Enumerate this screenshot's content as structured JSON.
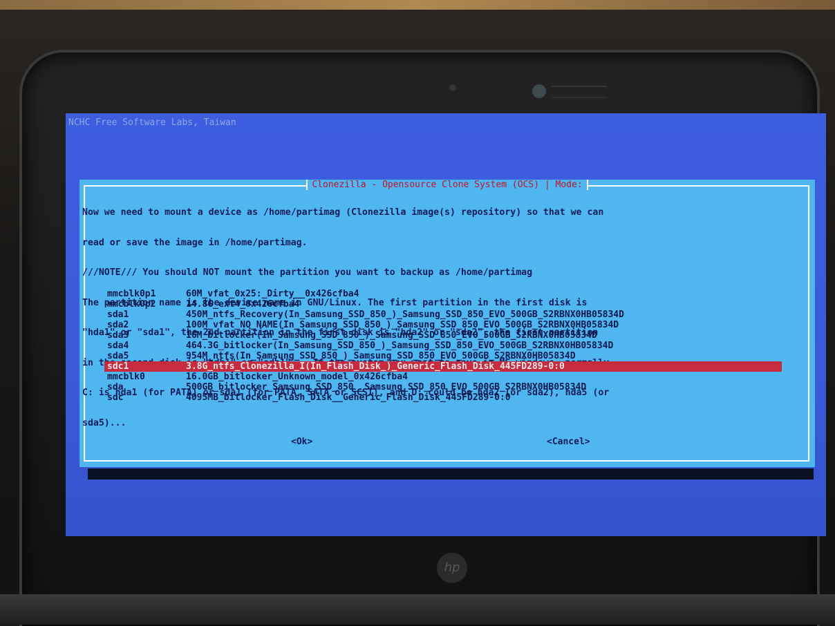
{
  "banner": "NCHC Free Software Labs, Taiwan",
  "dialog": {
    "title": "Clonezilla - Opensource Clone System (OCS) | Mode:",
    "message_lines": [
      "Now we need to mount a device as /home/partimag (Clonezilla image(s) repository) so that we can",
      "read or save the image in /home/partimag.",
      "///NOTE/// You should NOT mount the partition you want to backup as /home/partimag",
      "The partition name is the device name in GNU/Linux. The first partition in the first disk is",
      "\"hda1\" or \"sda1\", the 2nd partition in the first disk is \"hda2\" or \"sda2\", the first partition",
      "in the second disk is \"hdb1\" or \"sdb1\"... If the system you want to save is MS windows, normally",
      "C: is hda1 (for PATA) or sda1 (for PATA, SATA or SCSI), and D: could be hda2 (or sda2), hda5 (or",
      "sda5)..."
    ],
    "devices": [
      {
        "dev": "mmcblk0p1",
        "desc": "60M_vfat_0x25:_Dirty__0x426cfba4"
      },
      {
        "dev": "mmcblk0p2",
        "desc": "14.8G_ext4_0x426cfba4"
      },
      {
        "dev": "sda1",
        "desc": "450M_ntfs_Recovery(In_Samsung_SSD_850_)_Samsung_SSD_850_EVO_500GB_S2RBNX0HB05834D"
      },
      {
        "dev": "sda2",
        "desc": "100M_vfat_NO_NAME(In_Samsung_SSD_850_)_Samsung_SSD_850_EVO_500GB_S2RBNX0HB05834D"
      },
      {
        "dev": "sda3",
        "desc": "16M_bitlocker(In_Samsung_SSD_850_)_Samsung_SSD_850_EVO_500GB_S2RBNX0HB05834D"
      },
      {
        "dev": "sda4",
        "desc": "464.3G_bitlocker(In_Samsung_SSD_850_)_Samsung_SSD_850_EVO_500GB_S2RBNX0HB05834D"
      },
      {
        "dev": "sda5",
        "desc": "954M_ntfs(In_Samsung_SSD_850_)_Samsung_SSD_850_EVO_500GB_S2RBNX0HB05834D"
      },
      {
        "dev": "sdc1",
        "desc": "3.8G_ntfs_Clonezilla_I(In_Flash_Disk_)_Generic_Flash_Disk_445FD289-0:0"
      },
      {
        "dev": "mmcblk0",
        "desc": "16.0GB_bitlocker_Unknown_model_0x426cfba4"
      },
      {
        "dev": "sda",
        "desc": "500GB_bitlocker_Samsung_SSD_850__Samsung_SSD_850_EVO_500GB_S2RBNX0HB05834D"
      },
      {
        "dev": "sdc",
        "desc": "4095MB_bitlocker_Flash_Disk__Generic_Flash_Disk_445FD289-0:0"
      }
    ],
    "selected_device": "sdc1",
    "ok_label": "<Ok>",
    "cancel_label": "<Cancel>"
  },
  "colors": {
    "screen_bg": "#3a5ad8",
    "dialog_bg": "#4fb6f0",
    "title_text": "#c4142b",
    "selection_bg": "#c62b3e"
  },
  "icons": {
    "laptop_logo": "hp-logo-icon",
    "camera": "webcam-icon",
    "camera_app": "camera-app-icon"
  }
}
